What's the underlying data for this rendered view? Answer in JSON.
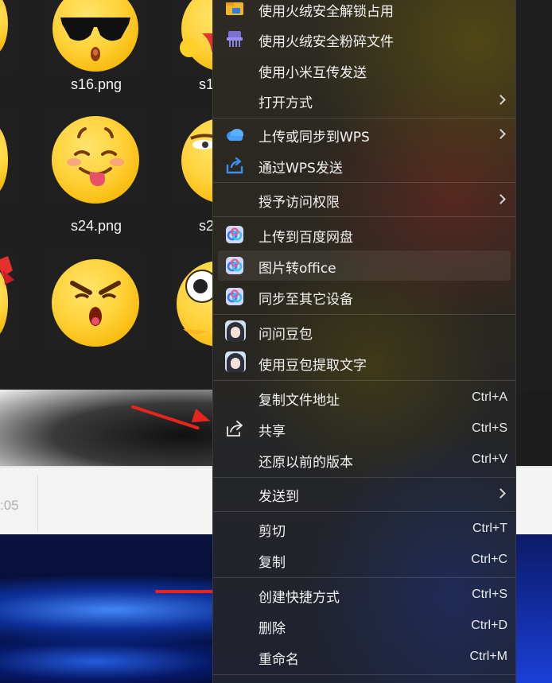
{
  "explorer": {
    "files": [
      {
        "name": "s16.png"
      },
      {
        "name": "s1"
      },
      {
        "name": "s24.png"
      },
      {
        "name": "s2"
      }
    ],
    "time_fragment": ":05"
  },
  "menu": {
    "items": [
      {
        "label": "使用火绒安全解锁占用",
        "icon": "folder-lock-icon"
      },
      {
        "label": "使用火绒安全粉碎文件",
        "icon": "shredder-icon"
      },
      {
        "label": "使用小米互传发送"
      },
      {
        "label": "打开方式",
        "submenu": true
      },
      {
        "label": "上传或同步到WPS",
        "icon": "wps-cloud-icon",
        "submenu": true
      },
      {
        "label": "通过WPS发送",
        "icon": "wps-share-icon"
      },
      {
        "label": "授予访问权限",
        "submenu": true
      },
      {
        "label": "上传到百度网盘",
        "icon": "baidu-netdisk-icon"
      },
      {
        "label": "图片转office",
        "icon": "baidu-netdisk-icon"
      },
      {
        "label": "同步至其它设备",
        "icon": "baidu-netdisk-icon"
      },
      {
        "label": "问问豆包",
        "icon": "doubao-avatar-icon"
      },
      {
        "label": "使用豆包提取文字",
        "icon": "doubao-avatar-icon"
      },
      {
        "label": "复制文件地址",
        "shortcut": "Ctrl+A"
      },
      {
        "label": "共享",
        "icon": "share-icon",
        "shortcut": "Ctrl+S"
      },
      {
        "label": "还原以前的版本",
        "shortcut": "Ctrl+V"
      },
      {
        "label": "发送到",
        "submenu": true
      },
      {
        "label": "剪切",
        "shortcut": "Ctrl+T"
      },
      {
        "label": "复制",
        "shortcut": "Ctrl+C"
      },
      {
        "label": "创建快捷方式",
        "shortcut": "Ctrl+S"
      },
      {
        "label": "删除",
        "shortcut": "Ctrl+D"
      },
      {
        "label": "重命名",
        "shortcut": "Ctrl+M"
      }
    ]
  },
  "colors": {
    "arrow": "#e8241f",
    "emoji": "#ffd23a"
  }
}
